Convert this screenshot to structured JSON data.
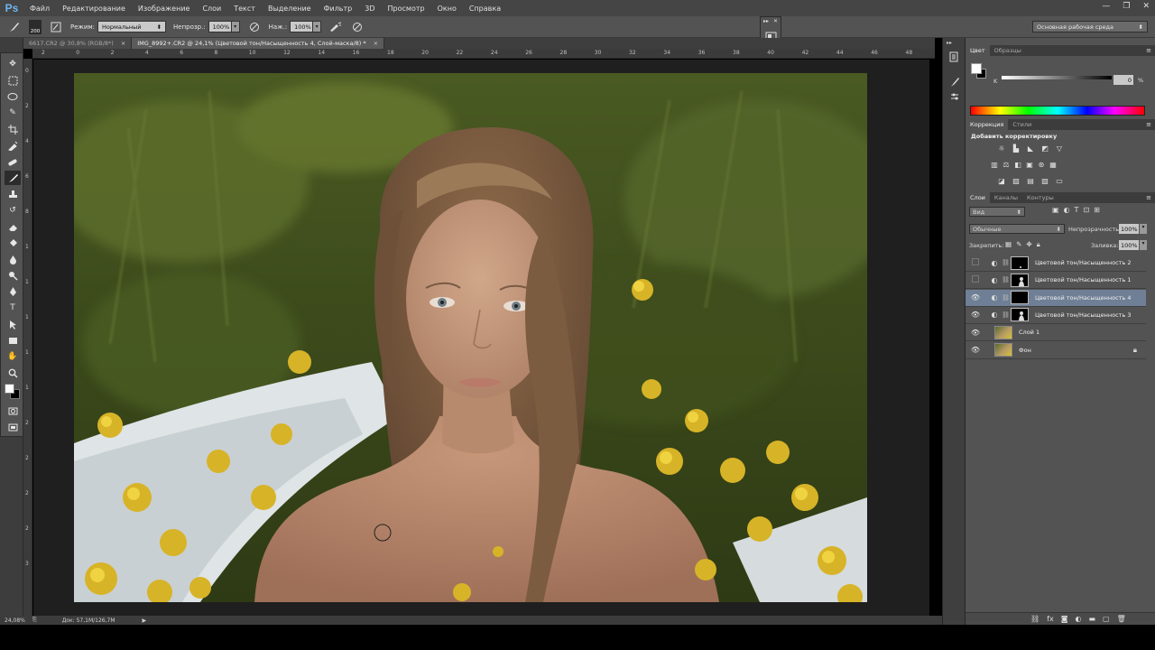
{
  "app": {
    "logo": "Ps"
  },
  "menu": [
    "Файл",
    "Редактирование",
    "Изображение",
    "Слои",
    "Текст",
    "Выделение",
    "Фильтр",
    "3D",
    "Просмотр",
    "Окно",
    "Справка"
  ],
  "options": {
    "brush_size": "200",
    "mode_label": "Режим:",
    "mode_value": "Нормальный",
    "opacity_label": "Непрозр.:",
    "opacity_value": "100%",
    "flow_label": "Наж.:",
    "flow_value": "100%",
    "workspace": "Основная рабочая среда"
  },
  "doc_tabs": [
    {
      "label": "6617.CR2 @ 30,8% (RGB/8*)",
      "active": false
    },
    {
      "label": "IMG_8992+.CR2 @ 24,1% (Цветовой тон/Насыщенность 4, Слой-маска/8) *",
      "active": true
    }
  ],
  "ruler_top": [
    "2",
    "0",
    "2",
    "4",
    "6",
    "8",
    "10",
    "12",
    "14",
    "16",
    "18",
    "20",
    "22",
    "24",
    "26",
    "28",
    "30",
    "32",
    "34",
    "36",
    "38",
    "40",
    "42",
    "44",
    "46",
    "48"
  ],
  "ruler_left": [
    "0",
    "2",
    "4",
    "6",
    "8",
    "1",
    "1",
    "1",
    "1",
    "1",
    "2",
    "2",
    "2",
    "2",
    "3"
  ],
  "status": {
    "zoom": "24,08%",
    "doc": "Док: 57,1M/126,7M"
  },
  "color_panel": {
    "tabs": [
      "Цвет",
      "Образцы"
    ],
    "channel": "K",
    "value": "0",
    "unit": "%"
  },
  "adjustments_panel": {
    "tabs": [
      "Коррекция",
      "Стили"
    ],
    "title": "Добавить корректировку",
    "icons": [
      "brightness-icon",
      "levels-icon",
      "curves-icon",
      "exposure-icon",
      "vibrance-icon",
      "hue-sat-icon",
      "color-balance-icon",
      "bw-icon",
      "photo-filter-icon",
      "channel-mixer-icon",
      "color-lookup-icon",
      "invert-icon",
      "posterize-icon",
      "threshold-icon",
      "selective-color-icon",
      "gradient-map-icon"
    ]
  },
  "layers_panel": {
    "tabs": [
      "Слои",
      "Каналы",
      "Контуры"
    ],
    "filter": "Вид",
    "blend": "Обычные",
    "opacity_label": "Непрозрачность:",
    "opacity_value": "100%",
    "lock_label": "Закрепить:",
    "fill_label": "Заливка:",
    "fill_value": "100%",
    "layers": [
      {
        "name": "Цветовой тон/Насыщенность 2",
        "visible": false,
        "selected": false,
        "type": "adjustment"
      },
      {
        "name": "Цветовой тон/Насыщенность 1",
        "visible": false,
        "selected": false,
        "type": "adjustment"
      },
      {
        "name": "Цветовой тон/Насыщенность 4",
        "visible": true,
        "selected": true,
        "type": "adjustment"
      },
      {
        "name": "Цветовой тон/Насыщенность 3",
        "visible": true,
        "selected": false,
        "type": "adjustment"
      },
      {
        "name": "Слой 1",
        "visible": true,
        "selected": false,
        "type": "pixel"
      },
      {
        "name": "Фон",
        "visible": true,
        "selected": false,
        "type": "background"
      }
    ]
  },
  "colors": {
    "ui_dark": "#535353",
    "selection": "#6f7f95",
    "ps_blue": "#6fb4f2"
  }
}
